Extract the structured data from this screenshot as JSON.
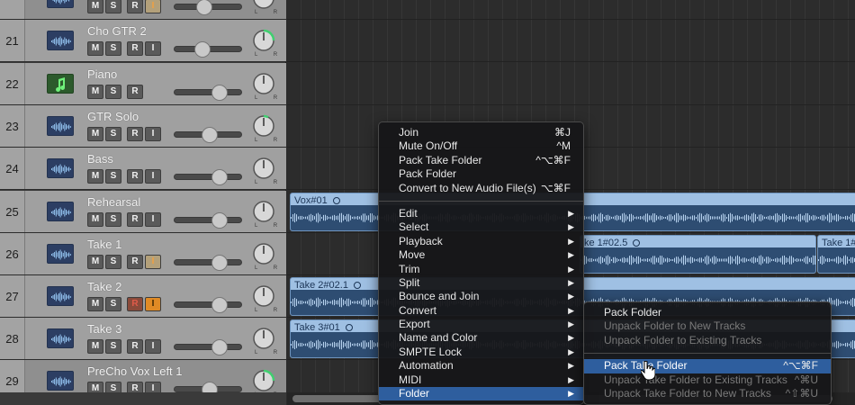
{
  "tracks": [
    {
      "num": "",
      "name": "",
      "icon": "audio-waveform-icon",
      "buttons": [
        "M",
        "S",
        "R",
        "I"
      ],
      "input_style": "input-on",
      "fader": 0.42,
      "pan_ring": "green"
    },
    {
      "num": "21",
      "name": "Cho GTR 2",
      "icon": "audio-waveform-icon",
      "buttons": [
        "M",
        "S",
        "R",
        "I"
      ],
      "input_style": "",
      "fader": 0.38,
      "pan_ring": "green"
    },
    {
      "num": "22",
      "name": "Piano",
      "icon": "music-note-icon",
      "buttons": [
        "M",
        "S",
        "R"
      ],
      "input_style": "",
      "fader": 0.7,
      "pan_ring": "none"
    },
    {
      "num": "23",
      "name": "GTR Solo",
      "icon": "audio-waveform-icon",
      "buttons": [
        "M",
        "S",
        "R",
        "I"
      ],
      "input_style": "",
      "fader": 0.52,
      "pan_ring": "green-small"
    },
    {
      "num": "24",
      "name": "Bass",
      "icon": "audio-waveform-icon",
      "buttons": [
        "M",
        "S",
        "R",
        "I"
      ],
      "input_style": "",
      "fader": 0.7,
      "pan_ring": "none"
    },
    {
      "num": "25",
      "name": "Rehearsal",
      "icon": "audio-waveform-icon",
      "buttons": [
        "M",
        "S",
        "R",
        "I"
      ],
      "input_style": "",
      "fader": 0.7,
      "pan_ring": "none"
    },
    {
      "num": "26",
      "name": "Take 1",
      "icon": "audio-waveform-icon",
      "buttons": [
        "M",
        "S",
        "R",
        "I"
      ],
      "input_style": "input-on",
      "fader": 0.7,
      "pan_ring": "none"
    },
    {
      "num": "27",
      "name": "Take 2",
      "icon": "audio-waveform-icon",
      "buttons": [
        "M",
        "S",
        "R",
        "I"
      ],
      "input_style": "rec-armed",
      "fader": 0.7,
      "pan_ring": "none"
    },
    {
      "num": "28",
      "name": "Take 3",
      "icon": "audio-waveform-icon",
      "buttons": [
        "M",
        "S",
        "R",
        "I"
      ],
      "input_style": "",
      "fader": 0.7,
      "pan_ring": "none"
    },
    {
      "num": "29",
      "name": "PreCho Vox Left 1",
      "icon": "audio-waveform-icon",
      "buttons": [
        "M",
        "S",
        "R",
        "I"
      ],
      "input_style": "",
      "fader": 0.52,
      "pan_ring": "green"
    }
  ],
  "pan_label": "L R",
  "regions": [
    {
      "name": "Vox#01",
      "track": 5
    },
    {
      "name": "ke 1#02.5",
      "track": 6
    },
    {
      "name": "Take 1#",
      "track": 6
    },
    {
      "name": "Take 2#02.1",
      "track": 7
    },
    {
      "name": "Take 3#01",
      "track": 8
    }
  ],
  "context_menu": {
    "groups": [
      [
        {
          "label": "Join",
          "shortcut": "⌘J"
        },
        {
          "label": "Mute On/Off",
          "shortcut": "^M"
        },
        {
          "label": "Pack Take Folder",
          "shortcut": "^⌥⌘F"
        },
        {
          "label": "Pack Folder",
          "shortcut": ""
        },
        {
          "label": "Convert to New Audio File(s)",
          "shortcut": "⌥⌘F"
        }
      ],
      [
        {
          "label": "Edit",
          "submenu": true
        },
        {
          "label": "Select",
          "submenu": true
        },
        {
          "label": "Playback",
          "submenu": true
        },
        {
          "label": "Move",
          "submenu": true
        },
        {
          "label": "Trim",
          "submenu": true
        },
        {
          "label": "Split",
          "submenu": true
        },
        {
          "label": "Bounce and Join",
          "submenu": true
        },
        {
          "label": "Convert",
          "submenu": true
        },
        {
          "label": "Export",
          "submenu": true
        },
        {
          "label": "Name and Color",
          "submenu": true
        },
        {
          "label": "SMPTE Lock",
          "submenu": true
        },
        {
          "label": "Automation",
          "submenu": true
        },
        {
          "label": "MIDI",
          "submenu": true
        },
        {
          "label": "Folder",
          "submenu": true,
          "selected": true
        }
      ]
    ]
  },
  "folder_submenu": {
    "groups": [
      [
        {
          "label": "Pack Folder",
          "shortcut": "",
          "disabled": false
        },
        {
          "label": "Unpack Folder to New Tracks",
          "shortcut": "",
          "disabled": true
        },
        {
          "label": "Unpack Folder to Existing Tracks",
          "shortcut": "",
          "disabled": true
        }
      ],
      [
        {
          "label": "Pack Take Folder",
          "shortcut": "^⌥⌘F",
          "disabled": false,
          "selected": true
        },
        {
          "label": "Unpack Take Folder to Existing Tracks",
          "shortcut": "^⌘U",
          "disabled": true
        },
        {
          "label": "Unpack Take Folder to New Tracks",
          "shortcut": "^⇧⌘U",
          "disabled": true
        }
      ]
    ]
  },
  "colors": {
    "selection": "#2e5e9e",
    "region": "#9fc0e3",
    "region_wave": "#2e4d72",
    "pan_green": "#3fcf6f"
  }
}
